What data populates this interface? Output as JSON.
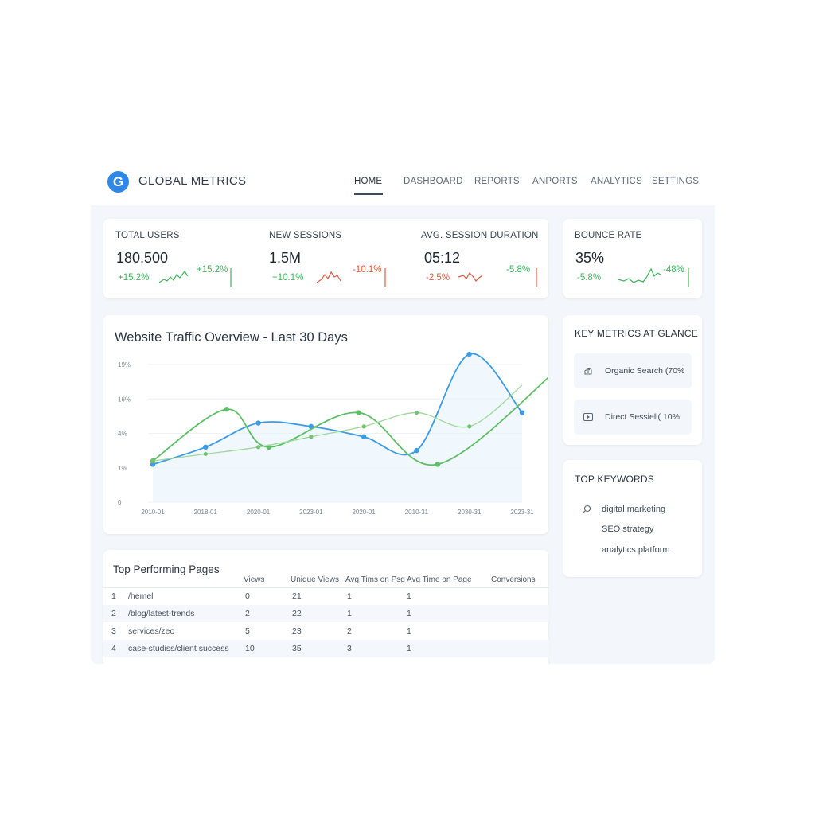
{
  "app": {
    "brand": "GLOBAL METRICS",
    "logo_letter": "G"
  },
  "nav": [
    {
      "label": "HOME",
      "active": true
    },
    {
      "label": "DASHBOARD"
    },
    {
      "label": "REPORTS"
    },
    {
      "label": "ANPORTS"
    },
    {
      "label": "ANALYTICS"
    },
    {
      "label": "SETTINGS"
    }
  ],
  "kpis": [
    {
      "label": "TOTAL USERS",
      "value": "180,500",
      "change": "+15.2%",
      "change2": "+15.2%",
      "trend": "up",
      "color": "#3cb35a"
    },
    {
      "label": "NEW SESSIONS",
      "value": "1.5M",
      "change": "+10.1%",
      "change2": "-10.1%",
      "trend": "down",
      "color": "#e3593e"
    },
    {
      "label": "AVG. SESSION DURATION",
      "value": "05:12",
      "change": "-2.5%",
      "change2": "-5.8%",
      "trend": "down",
      "color": "#e3593e"
    },
    {
      "label": "BOUNCE RATE",
      "value": "35%",
      "change": "-5.8%",
      "change2": "-48%",
      "trend": "up",
      "color": "#3cb35a"
    }
  ],
  "traffic": {
    "title": "Website Traffic Overview - Last 30 Days",
    "chart_data": {
      "type": "line",
      "title": "Website Traffic Overview - Last 30 Days",
      "y_tick_labels": [
        "0",
        "1%",
        "4%",
        "16%",
        "19%"
      ],
      "x_tick_labels": [
        "2010-01",
        "2018-01",
        "2020-01",
        "2023-01",
        "2020-01",
        "2010-31",
        "2030-31",
        "2023-31"
      ],
      "ylim": [
        0,
        4
      ],
      "grid": true,
      "series": [
        {
          "color": "#3b9be6",
          "values": [
            1.1,
            1.6,
            2.3,
            2.2,
            1.9,
            1.5,
            4.3,
            2.6
          ]
        },
        {
          "color": "#5cbf66",
          "values": [
            1.2,
            2.7,
            1.6,
            2.6,
            1.1,
            3.9
          ],
          "x": [
            0,
            1.4,
            2.2,
            3.9,
            5.4,
            7.7
          ]
        },
        {
          "color": "#9fd89c",
          "values": [
            1.2,
            1.4,
            1.6,
            1.9,
            2.2,
            2.6,
            2.2,
            3.4
          ]
        }
      ]
    }
  },
  "key_metrics": {
    "title": "KEY METRICS AT GLANCE",
    "items": [
      {
        "label": "Organic Search (70%",
        "icon": "upload-cloud-icon"
      },
      {
        "label": "Direct Sessiell( 10%",
        "icon": "play-square-icon"
      }
    ]
  },
  "keywords": {
    "title": "TOP KEYWORDS",
    "items": [
      "digital marketing",
      "SEO strategy",
      "analytics platform"
    ]
  },
  "pages": {
    "title": "Top Performing Pages",
    "columns": [
      "Views",
      "Unique Views",
      "Avg Tims on Psg",
      "Avg Time on Page",
      "Conversions"
    ],
    "rows": [
      {
        "n": "1",
        "path": "/hemel",
        "views": "0",
        "unique": "21",
        "avg1": "1",
        "avg2": "1"
      },
      {
        "n": "2",
        "path": "/blog/latest-trends",
        "views": "2",
        "unique": "22",
        "avg1": "1",
        "avg2": "1"
      },
      {
        "n": "3",
        "path": "services/zeo",
        "views": "5",
        "unique": "23",
        "avg1": "2",
        "avg2": "1"
      },
      {
        "n": "4",
        "path": "case-studiss/client success",
        "views": "10",
        "unique": "35",
        "avg1": "3",
        "avg2": "1"
      }
    ]
  }
}
